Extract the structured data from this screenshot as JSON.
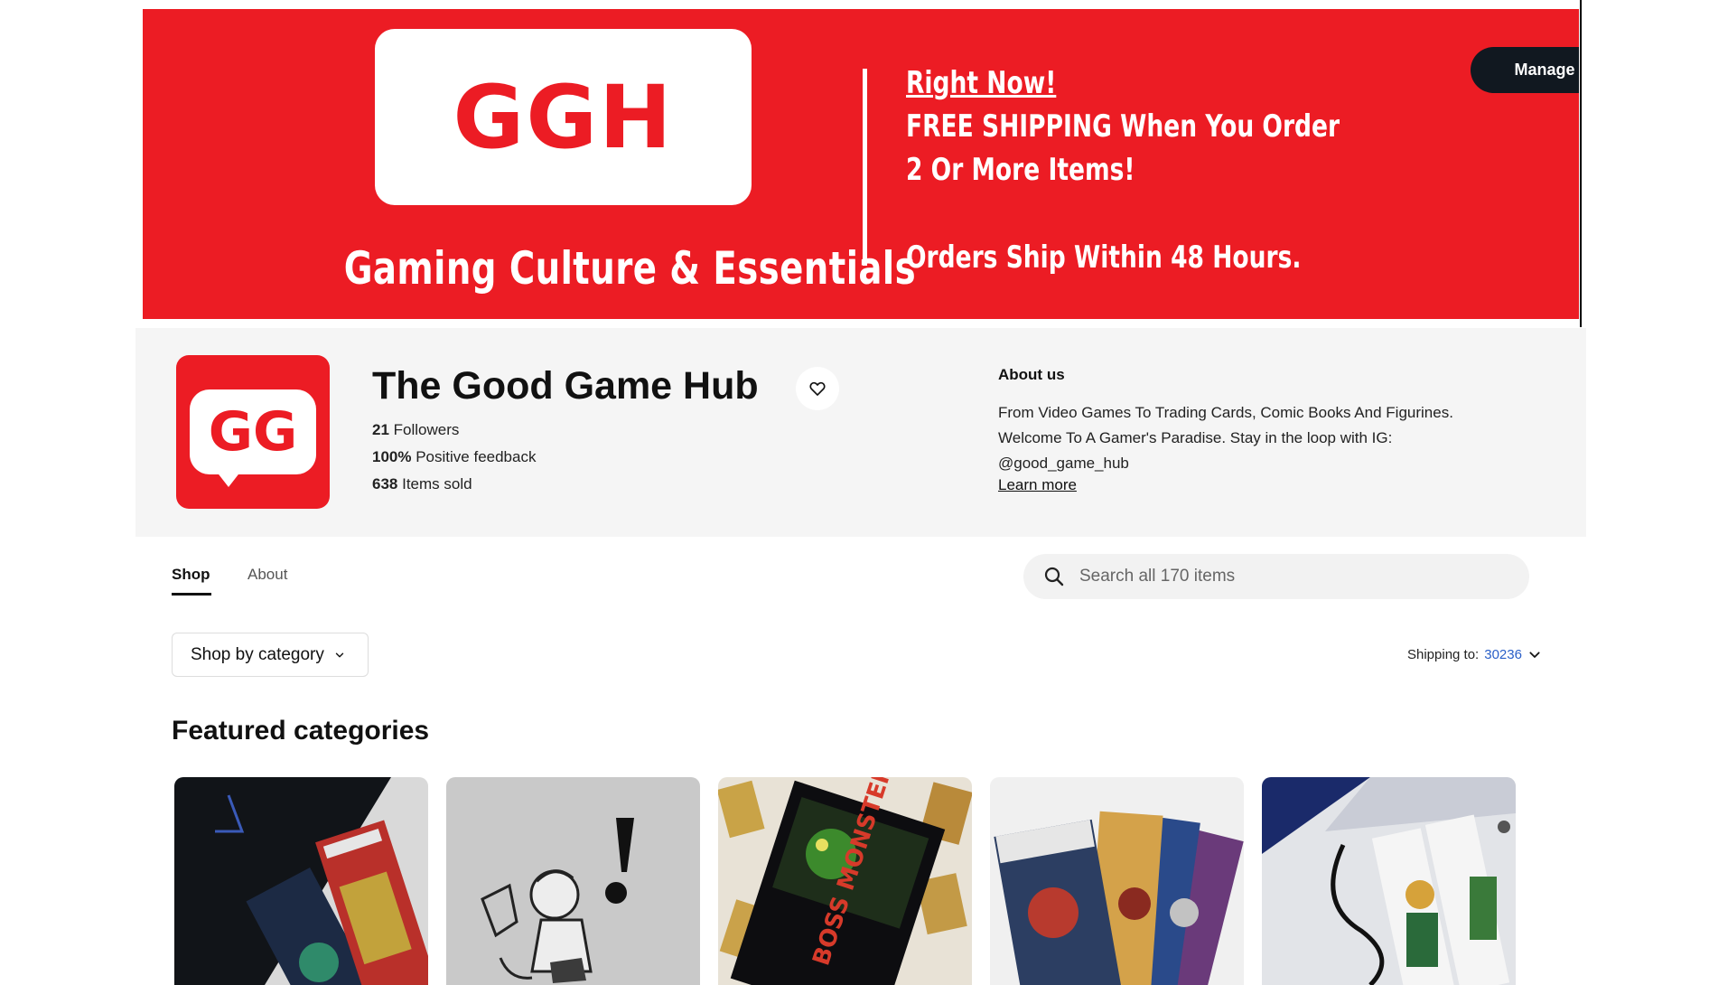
{
  "banner": {
    "logo_text": "GGH",
    "tagline": "Gaming Culture & Essentials",
    "promo_line1": "Right Now!",
    "promo_line2": "FREE SHIPPING When You Order",
    "promo_line3": "2 Or More Items!",
    "promo_line4": "Orders Ship Within 48 Hours.",
    "manage_button": "Manage my store",
    "colors": {
      "brand_red": "#ec1c24",
      "button_dark": "#111820"
    }
  },
  "store": {
    "logo_text": "GG",
    "name": "The Good Game Hub",
    "followers_count": "21",
    "followers_label": "Followers",
    "feedback_value": "100%",
    "feedback_label": "Positive feedback",
    "sold_count": "638",
    "sold_label": "Items sold",
    "favorite_icon": "heart-icon"
  },
  "about": {
    "title": "About us",
    "text": "From Video Games To Trading Cards, Comic Books And Figurines. Welcome To A Gamer's Paradise. Stay in the loop with IG: @good_game_hub",
    "learn_more": "Learn more"
  },
  "tabs": [
    {
      "label": "Shop",
      "active": true
    },
    {
      "label": "About",
      "active": false
    }
  ],
  "search": {
    "placeholder": "Search all 170 items",
    "icon": "search-icon"
  },
  "filters": {
    "category_button": "Shop by category",
    "shipping_label": "Shipping to:",
    "shipping_zip": "30236"
  },
  "featured": {
    "title": "Featured categories",
    "cards": [
      {
        "image": "playstation-2-games-photo"
      },
      {
        "image": "cartoon-illustration-photo"
      },
      {
        "image": "retro-game-box-photo"
      },
      {
        "image": "comic-books-photo"
      },
      {
        "image": "gamecube-console-photo"
      }
    ]
  }
}
